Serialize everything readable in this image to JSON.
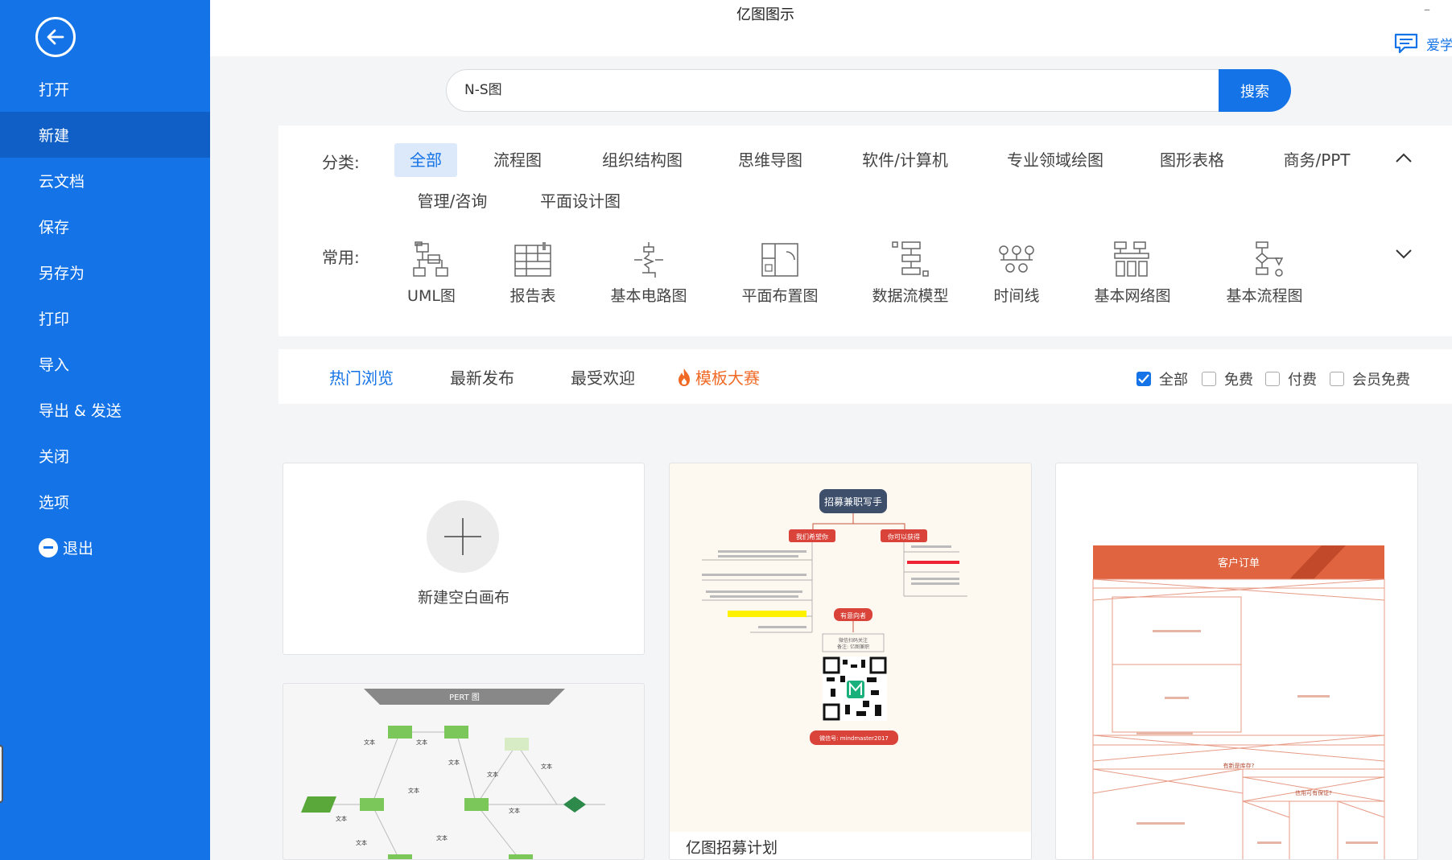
{
  "app": {
    "title": "亿图图示",
    "minimize": "–",
    "user_name": "爱学"
  },
  "sidebar": {
    "items": [
      {
        "label": "打开"
      },
      {
        "label": "新建"
      },
      {
        "label": "云文档"
      },
      {
        "label": "保存"
      },
      {
        "label": "另存为"
      },
      {
        "label": "打印"
      },
      {
        "label": "导入"
      },
      {
        "label": "导出 & 发送"
      },
      {
        "label": "关闭"
      },
      {
        "label": "选项"
      },
      {
        "label": "退出"
      }
    ],
    "active": "新建"
  },
  "search": {
    "value": "N-S图",
    "button": "搜索"
  },
  "categories": {
    "label": "分类:",
    "items": [
      "全部",
      "流程图",
      "组织结构图",
      "思维导图",
      "软件/计算机",
      "专业领域绘图",
      "图形表格",
      "商务/PPT",
      "管理/咨询",
      "平面设计图"
    ],
    "active": "全部"
  },
  "common": {
    "label": "常用:",
    "items": [
      {
        "label": "UML图",
        "icon": "uml-icon"
      },
      {
        "label": "报告表",
        "icon": "report-table-icon"
      },
      {
        "label": "基本电路图",
        "icon": "circuit-icon"
      },
      {
        "label": "平面布置图",
        "icon": "floor-plan-icon"
      },
      {
        "label": "数据流模型",
        "icon": "data-flow-icon"
      },
      {
        "label": "时间线",
        "icon": "timeline-icon"
      },
      {
        "label": "基本网络图",
        "icon": "network-icon"
      },
      {
        "label": "基本流程图",
        "icon": "flowchart-icon"
      }
    ]
  },
  "tabs": {
    "items": [
      "热门浏览",
      "最新发布",
      "最受欢迎",
      "模板大赛"
    ],
    "active": "热门浏览"
  },
  "filters": [
    {
      "label": "全部",
      "checked": true
    },
    {
      "label": "免费",
      "checked": false
    },
    {
      "label": "付费",
      "checked": false
    },
    {
      "label": "会员免费",
      "checked": false
    }
  ],
  "cards": {
    "new_blank": "新建空白画布",
    "recruit": {
      "title": "亿图招募计划",
      "heading": "招募兼职写手",
      "left_branch": "我们希望你",
      "right_branch": "你可以获得",
      "contact": "有意向者",
      "scan_line1": "微信扫码关注",
      "scan_line2": "备注: 亿图兼职",
      "wechat": "微信号: mindmaster2017"
    },
    "order": {
      "heading": "客户订单",
      "question1": "有新是库存?",
      "question2": "信用可有保证?"
    },
    "pert": {
      "heading": "PERT 图",
      "node_label": "文本"
    }
  },
  "colors": {
    "sidebar": "#1473e6",
    "sidebar_active": "#0f5fc6",
    "accent": "#1473e6",
    "contest": "#f06a26",
    "order_header": "#e0643f"
  }
}
